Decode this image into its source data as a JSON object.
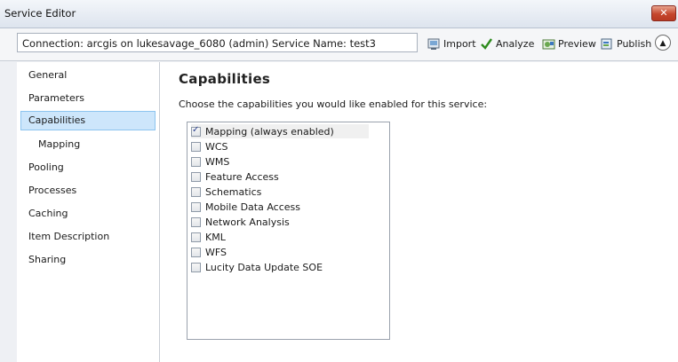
{
  "window": {
    "title": "Service Editor",
    "close_glyph": "✕"
  },
  "toolbar": {
    "connection_text": "Connection: arcgis on lukesavage_6080 (admin)   Service Name: test3",
    "buttons": [
      {
        "label": "Import",
        "icon": "import-icon"
      },
      {
        "label": "Analyze",
        "icon": "checkmark-icon"
      },
      {
        "label": "Preview",
        "icon": "preview-icon"
      },
      {
        "label": "Publish",
        "icon": "publish-icon"
      }
    ],
    "collapse_glyph": "▲"
  },
  "sidebar": {
    "items": [
      {
        "label": "General"
      },
      {
        "label": "Parameters"
      },
      {
        "label": "Capabilities",
        "selected": true
      },
      {
        "label": "Mapping",
        "indent": true
      },
      {
        "label": "Pooling"
      },
      {
        "label": "Processes"
      },
      {
        "label": "Caching"
      },
      {
        "label": "Item Description"
      },
      {
        "label": "Sharing"
      }
    ]
  },
  "main": {
    "heading": "Capabilities",
    "description": "Choose the capabilities you would like enabled for this service:",
    "capabilities": [
      {
        "label": "Mapping (always enabled)",
        "checked": true
      },
      {
        "label": "WCS",
        "checked": false
      },
      {
        "label": "WMS",
        "checked": false
      },
      {
        "label": "Feature Access",
        "checked": false
      },
      {
        "label": "Schematics",
        "checked": false
      },
      {
        "label": "Mobile Data Access",
        "checked": false
      },
      {
        "label": "Network Analysis",
        "checked": false
      },
      {
        "label": "KML",
        "checked": false
      },
      {
        "label": "WFS",
        "checked": false
      },
      {
        "label": "Lucity Data Update SOE",
        "checked": false
      }
    ]
  },
  "colors": {
    "selection_bg": "#cde6fb",
    "close_red": "#c5462c",
    "analyze_green": "#2e8b1e"
  }
}
